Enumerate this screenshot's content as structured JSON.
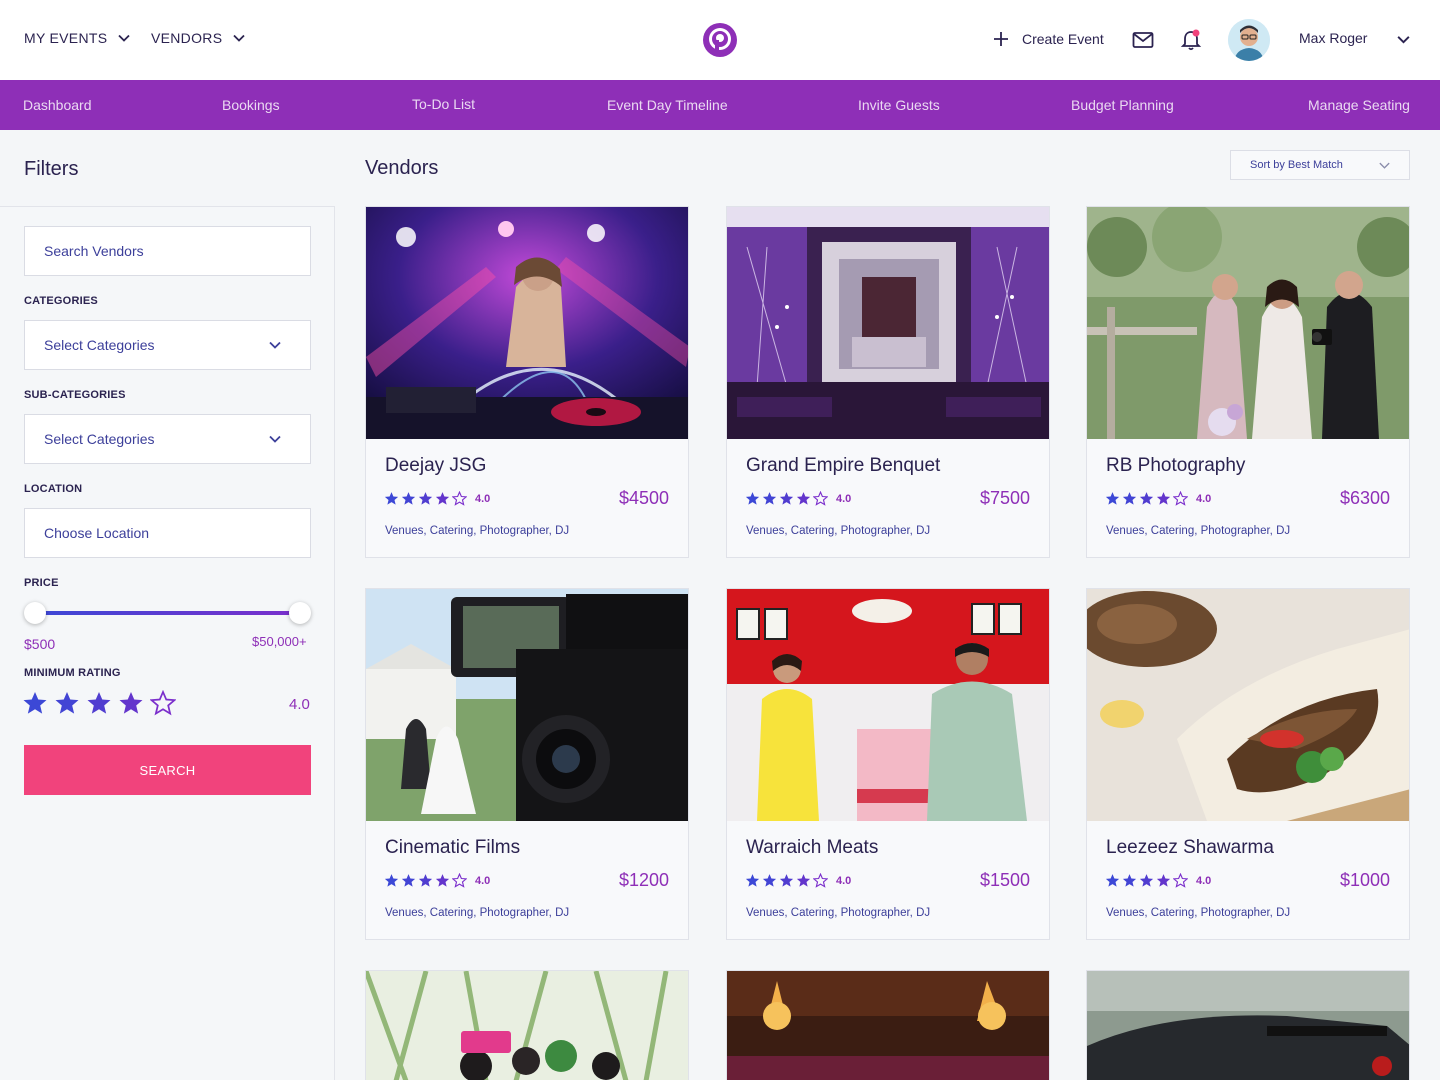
{
  "header": {
    "my_events": "MY EVENTS",
    "vendors": "VENDORS",
    "create_event": "Create Event",
    "user_name": "Max Roger"
  },
  "nav": [
    "Dashboard",
    "Bookings",
    "To-Do List",
    "Event Day Timeline",
    "Invite Guests",
    "Budget Planning",
    "Manage Seating"
  ],
  "filters": {
    "title": "Filters",
    "search_placeholder": "Search Vendors",
    "categories_label": "CATEGORIES",
    "categories_value": "Select Categories",
    "subcategories_label": "SUB-CATEGORIES",
    "subcategories_value": "Select Categories",
    "location_label": "LOCATION",
    "location_placeholder": "Choose Location",
    "price_label": "PRICE",
    "price_min": "$500",
    "price_max": "$50,000+",
    "rating_label": "MINIMUM RATING",
    "rating_value": "4.0",
    "search_button": "SEARCH"
  },
  "content": {
    "title": "Vendors",
    "sort_label": "Sort by Best Match"
  },
  "vendors": [
    {
      "name": "Deejay JSG",
      "rating": "4.0",
      "price": "$4500",
      "categories": "Venues, Catering, Photographer, DJ"
    },
    {
      "name": "Grand Empire Benquet",
      "rating": "4.0",
      "price": "$7500",
      "categories": "Venues, Catering, Photographer, DJ"
    },
    {
      "name": "RB Photography",
      "rating": "4.0",
      "price": "$6300",
      "categories": "Venues, Catering, Photographer, DJ"
    },
    {
      "name": "Cinematic Films",
      "rating": "4.0",
      "price": "$1200",
      "categories": "Venues, Catering, Photographer, DJ"
    },
    {
      "name": "Warraich Meats",
      "rating": "4.0",
      "price": "$1500",
      "categories": "Venues, Catering, Photographer, DJ"
    },
    {
      "name": "Leezeez Shawarma",
      "rating": "4.0",
      "price": "$1000",
      "categories": "Venues, Catering, Photographer, DJ"
    }
  ],
  "icons": {
    "logo": "brand-logo-icon",
    "create": "plus-icon",
    "mail": "mail-icon",
    "notifications": "bell-icon",
    "dropdown": "chevron-down-icon",
    "rating": "star-icon"
  },
  "colors": {
    "brand_purple": "#8e2fb7",
    "accent_pink": "#f1437c",
    "star_blue": "#3c48d6",
    "text_dark": "#2b2350"
  }
}
